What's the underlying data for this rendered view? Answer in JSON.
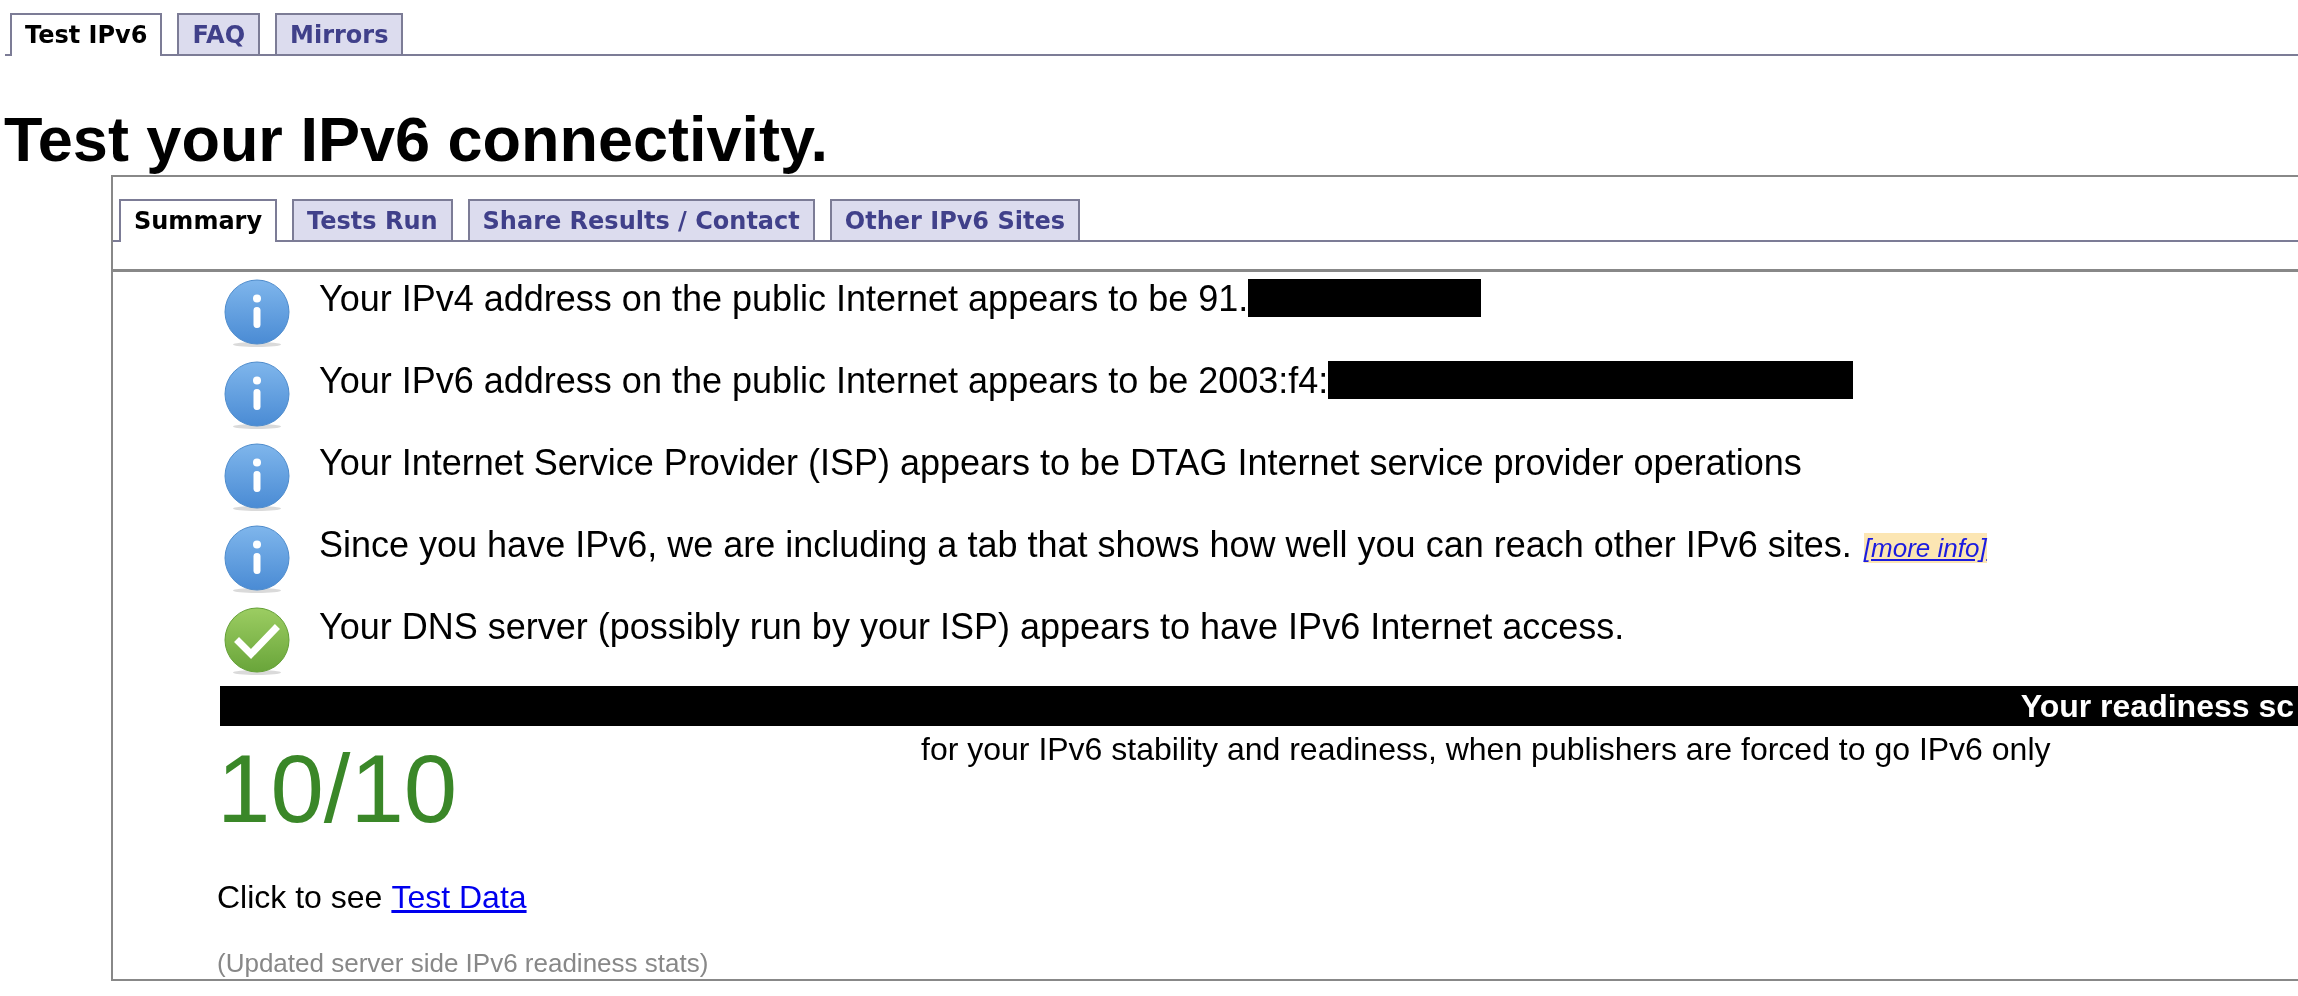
{
  "top_tabs": [
    {
      "label": "Test IPv6",
      "selected": true
    },
    {
      "label": "FAQ",
      "selected": false
    },
    {
      "label": "Mirrors",
      "selected": false
    }
  ],
  "heading": "Test your IPv6 connectivity.",
  "result_tabs": [
    {
      "label": "Summary",
      "selected": true
    },
    {
      "label": "Tests Run",
      "selected": false
    },
    {
      "label": "Share Results / Contact",
      "selected": false
    },
    {
      "label": "Other IPv6 Sites",
      "selected": false
    }
  ],
  "messages": [
    {
      "kind": "info",
      "text": "Your IPv4 address on the public Internet appears to be 91.",
      "redacted": true
    },
    {
      "kind": "info",
      "text": "Your IPv6 address on the public Internet appears to be 2003:f4:",
      "redacted": true
    },
    {
      "kind": "info",
      "text": "Your Internet Service Provider (ISP) appears to be DTAG Internet service provider operations",
      "redacted": false
    },
    {
      "kind": "info",
      "text": "Since you have IPv6, we are including a tab that shows how well you can reach other IPv6 sites.",
      "link": "[more info]",
      "redacted": false
    },
    {
      "kind": "success",
      "text": "Your DNS server (possibly run by your ISP) appears to have IPv6 Internet access.",
      "redacted": false
    }
  ],
  "readiness": {
    "header": "Your readiness sc",
    "score": "10/10",
    "description": "for your IPv6 stability and readiness, when publishers are forced to go IPv6 only"
  },
  "test_data": {
    "text": "Click to see",
    "link": "Test Data"
  },
  "footnote": "(Updated server side IPv6 readiness stats)"
}
